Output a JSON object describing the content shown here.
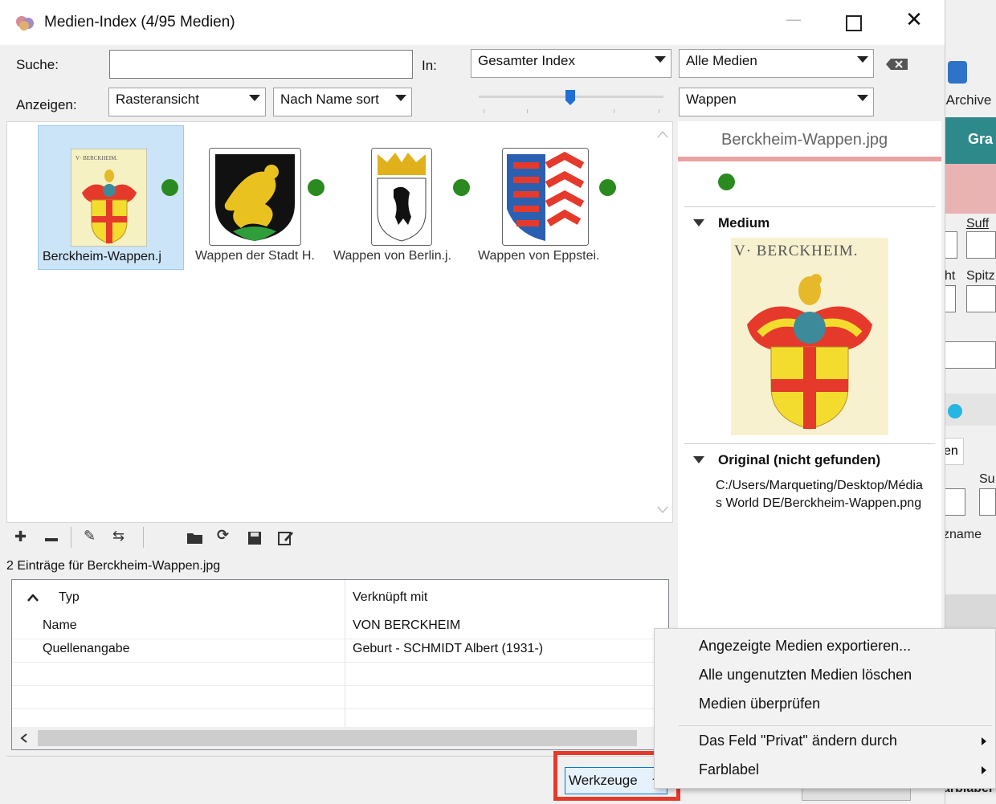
{
  "window": {
    "title": "Medien-Index (4/95 Medien)"
  },
  "toolbar": {
    "search_label": "Suche:",
    "search_value": "",
    "in_label": "In:",
    "scope_value": "Gesamter Index",
    "media_filter_value": "Alle Medien",
    "show_label": "Anzeigen:",
    "view_value": "Rasteransicht",
    "sort_value": "Nach Name sort",
    "category_value": "Wappen"
  },
  "grid": {
    "items": [
      {
        "caption": "Berckheim-Wappen.j",
        "selected": true
      },
      {
        "caption": "Wappen der Stadt H."
      },
      {
        "caption": "Wappen von Berlin.j."
      },
      {
        "caption": "Wappen von Eppstei."
      }
    ],
    "thumb_text_0": "V· BERCKHEIM."
  },
  "detail": {
    "filename": "Berckheim-Wappen.jpg",
    "medium_heading": "Medium",
    "image_text": "V· BERCKHEIM.",
    "original_heading": "Original (nicht gefunden)",
    "original_path": "C:/Users/Marqueting/Desktop/Médias World DE/Berckheim-Wappen.png"
  },
  "links": {
    "count_text": "2 Einträge für Berckheim-Wappen.jpg",
    "col_type": "Typ",
    "col_linked": "Verknüpft mit",
    "rows": [
      {
        "type": "Name",
        "linked": "VON BERCKHEIM"
      },
      {
        "type": "Quellenangabe",
        "linked": "Geburt - SCHMIDT Albert (1931-)"
      }
    ]
  },
  "footer": {
    "tools_button": "Werkzeuge"
  },
  "tools_menu": [
    "Angezeigte Medien exportieren...",
    "Alle ungenutzten Medien löschen",
    "Medien überprüfen",
    "Das Feld \"Privat\" ändern durch",
    "Farblabel"
  ],
  "background_app": {
    "archive": "-Archive",
    "tab_gra": "Gra",
    "suff": "Suff",
    "ht": "ht",
    "spitz": "Spitz",
    "en": "en",
    "su": "Su",
    "zname": "zname",
    "farblabel_partial": "arblabel"
  },
  "colors": {
    "accent_red": "#e53a2b",
    "status_green": "#2b8a1f",
    "selection": "#cce4f7"
  }
}
